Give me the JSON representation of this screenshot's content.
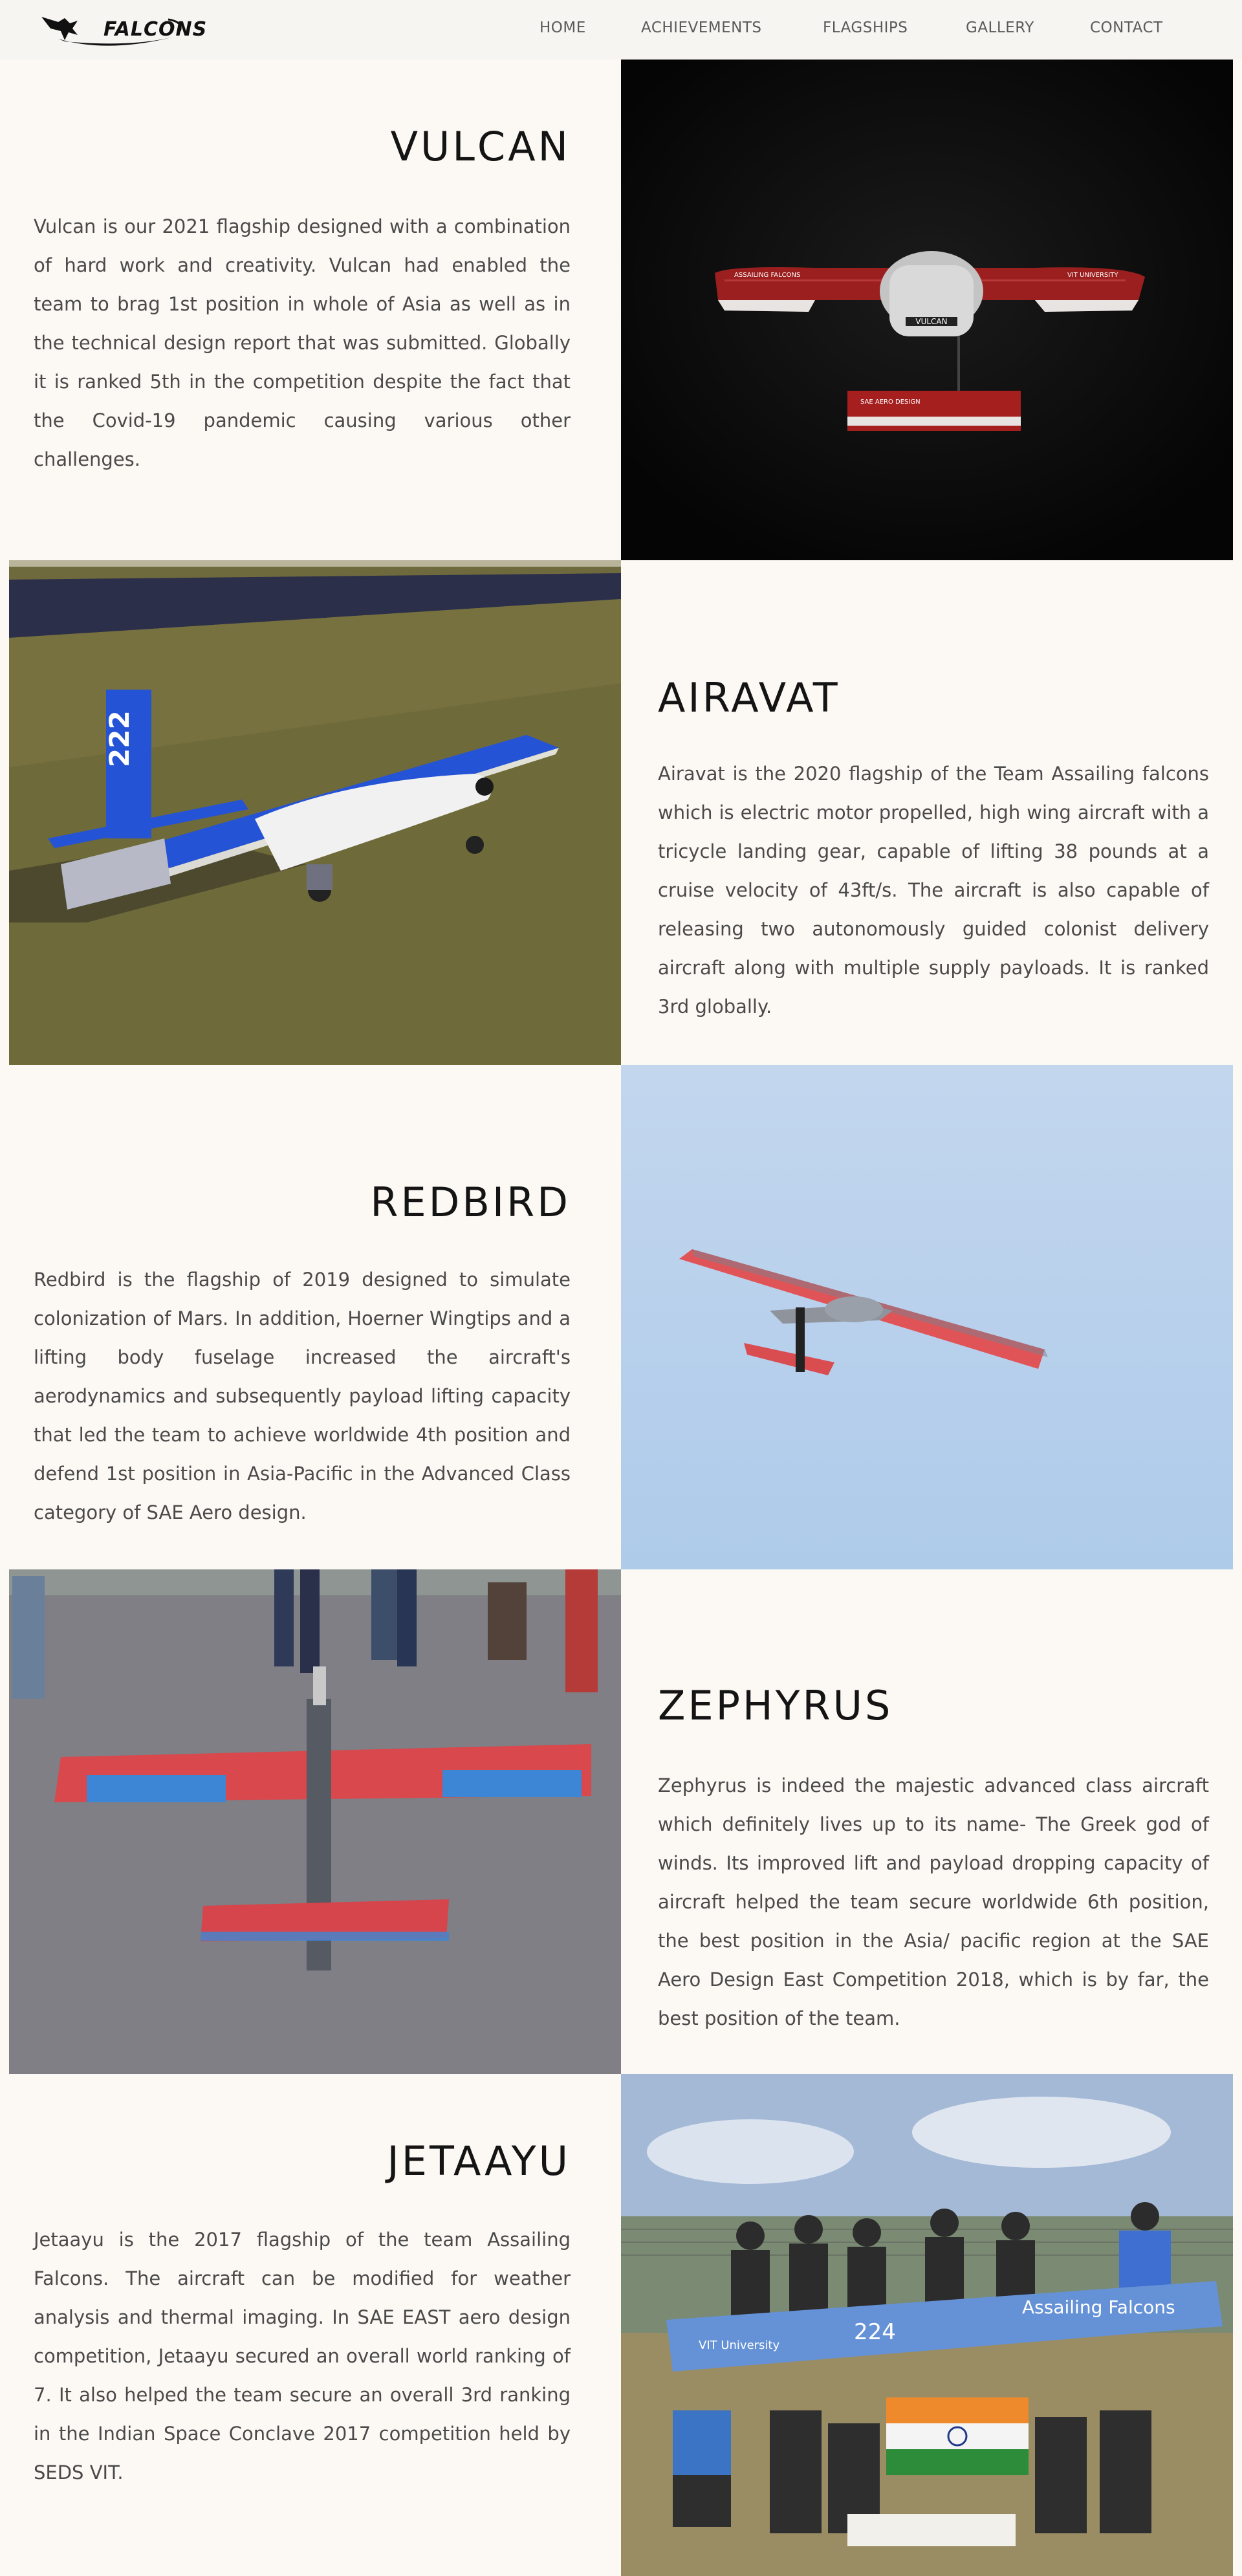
{
  "brand": {
    "logo_text": "FALCONS"
  },
  "nav": {
    "items": [
      {
        "label": "HOME"
      },
      {
        "label": "ACHIEVEMENTS"
      },
      {
        "label": "FLAGSHIPS"
      },
      {
        "label": "GALLERY"
      },
      {
        "label": "CONTACT"
      }
    ]
  },
  "flagships": [
    {
      "title": "VULCAN",
      "description": "Vulcan is our 2021 flagship designed with a combination of hard work and creativity. Vulcan had enabled the team to brag 1st position in whole of Asia as well as in the technical design report that was submitted. Globally it is ranked 5th in the competition despite the fact that the Covid-19 pandemic causing various other challenges.",
      "image_labels": {
        "wing_left": "ASSAILING FALCONS",
        "wing_right": "VIT UNIVERSITY",
        "fuselage": "VULCAN",
        "tail": "SAE AERO DESIGN"
      }
    },
    {
      "title": "AIRAVAT",
      "description": "Airavat is the 2020 flagship of the Team Assailing falcons which is electric motor propelled, high wing aircraft with a tricycle landing gear, capable of lifting 38 pounds at a cruise velocity of 43ft/s. The aircraft is also capable of releasing two autonomously guided colonist delivery aircraft along with multiple supply payloads. It is ranked 3rd globally.",
      "image_labels": {
        "tail_number": "222"
      }
    },
    {
      "title": "REDBIRD",
      "description": "Redbird is the flagship of 2019 designed to simulate colonization of Mars. In addition, Hoerner Wingtips and a lifting body fuselage increased the aircraft's aerodynamics and subsequently payload lifting capacity that led the team to achieve worldwide 4th position and defend 1st position in Asia-Pacific in the Advanced Class category of SAE Aero design."
    },
    {
      "title": "ZEPHYRUS",
      "description": "Zephyrus is indeed the majestic advanced class aircraft which definitely lives up to its name- The Greek god of winds. Its improved lift and payload dropping capacity of aircraft helped the team secure worldwide 6th position, the best position in the Asia/ pacific region at the SAE Aero Design East Competition 2018, which is by far, the best position of the team."
    },
    {
      "title": "JETAAYU",
      "description": "Jetaayu is the 2017 flagship of the team Assailing Falcons. The aircraft can be modified for weather analysis and thermal imaging. In SAE EAST aero design competition, Jetaayu secured an overall world ranking of 7. It also helped the team secure an overall 3rd ranking in the Indian Space Conclave 2017 competition held by SEDS VIT.",
      "image_labels": {
        "banner": "Assailing Falcons",
        "university": "VIT University",
        "number": "224"
      }
    }
  ],
  "colors": {
    "background": "#fcf9f4",
    "navbar": "#f7f5f2",
    "title": "#141414",
    "body_text": "#4a4a4a"
  }
}
